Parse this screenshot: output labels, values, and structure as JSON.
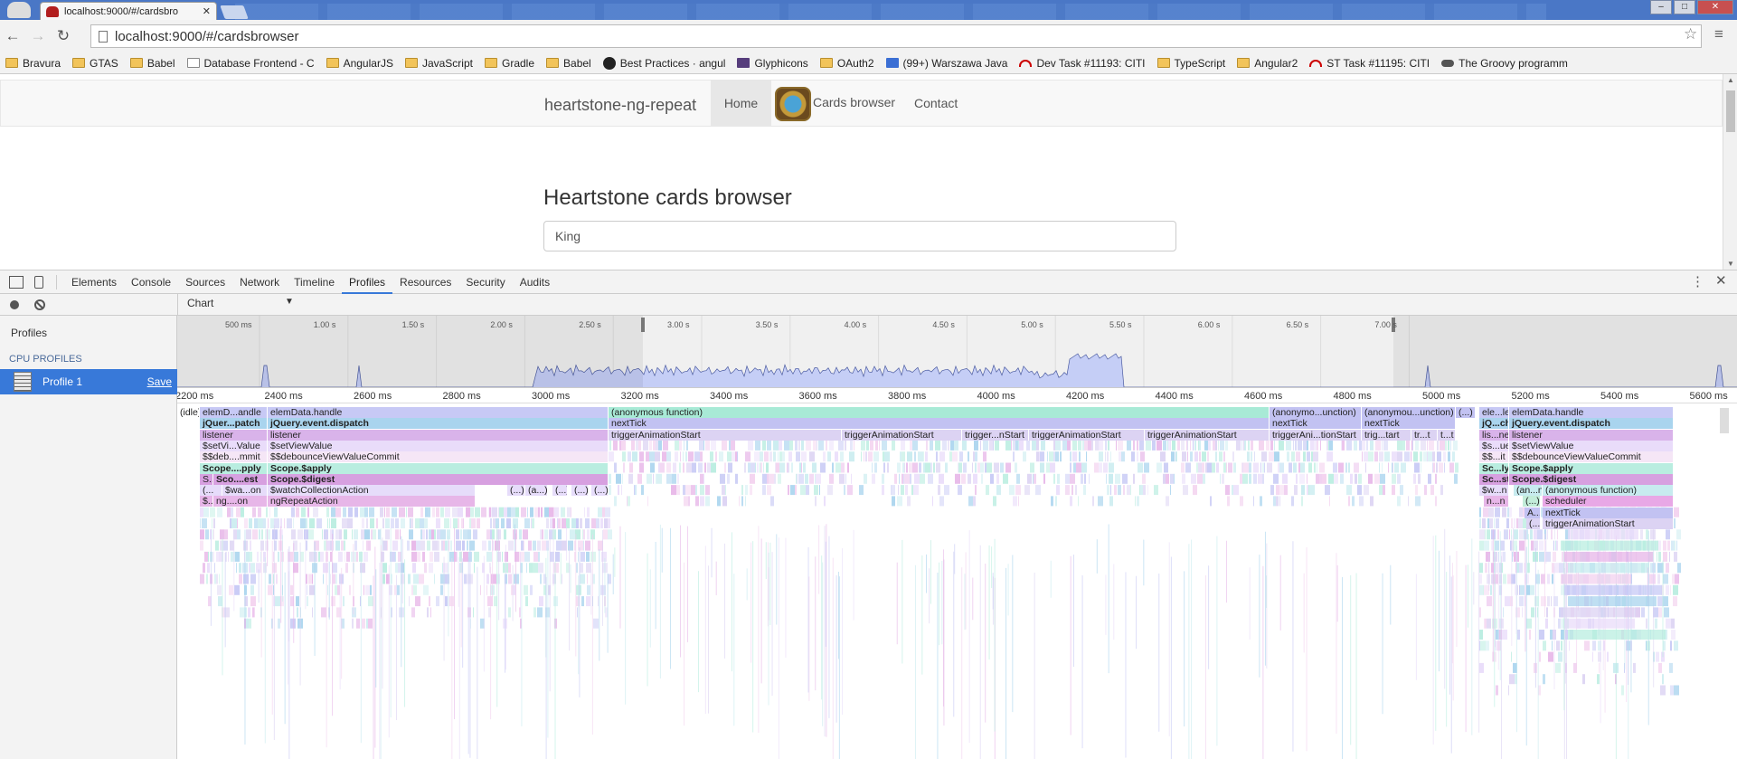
{
  "browser": {
    "tab_title": "localhost:9000/#/cardsbro",
    "url": "localhost:9000/#/cardsbrowser",
    "bookmarks": [
      {
        "label": "Bravura",
        "icon": "folder"
      },
      {
        "label": "GTAS",
        "icon": "folder"
      },
      {
        "label": "Babel",
        "icon": "folder"
      },
      {
        "label": "Database Frontend - C",
        "icon": "page"
      },
      {
        "label": "AngularJS",
        "icon": "folder"
      },
      {
        "label": "JavaScript",
        "icon": "folder"
      },
      {
        "label": "Gradle",
        "icon": "folder"
      },
      {
        "label": "Babel",
        "icon": "folder"
      },
      {
        "label": "Best Practices · angul",
        "icon": "gh"
      },
      {
        "label": "Glyphicons",
        "icon": "bs"
      },
      {
        "label": "OAuth2",
        "icon": "folder"
      },
      {
        "label": "(99+) Warszawa Java",
        "icon": "doc"
      },
      {
        "label": "Dev Task #11193: CITI",
        "icon": "jira"
      },
      {
        "label": "TypeScript",
        "icon": "folder"
      },
      {
        "label": "Angular2",
        "icon": "folder"
      },
      {
        "label": "ST Task #11195: CITI",
        "icon": "jira"
      },
      {
        "label": "The Groovy programm",
        "icon": "car"
      }
    ]
  },
  "page": {
    "brand": "heartstone-ng-repeat",
    "nav": {
      "home": "Home",
      "cards": "Cards browser",
      "contact": "Contact"
    },
    "heading": "Heartstone cards browser",
    "search_value": "King"
  },
  "devtools": {
    "tabs": [
      "Elements",
      "Console",
      "Sources",
      "Network",
      "Timeline",
      "Profiles",
      "Resources",
      "Security",
      "Audits"
    ],
    "active_tab": "Profiles",
    "view_select": "Chart",
    "sidebar": {
      "header": "Profiles",
      "section": "CPU PROFILES",
      "profile_name": "Profile 1",
      "save_label": "Save"
    },
    "overview_ticks": [
      "500 ms",
      "1.00 s",
      "1.50 s",
      "2.00 s",
      "2.50 s",
      "3.00 s",
      "3.50 s",
      "4.00 s",
      "4.50 s",
      "5.00 s",
      "5.50 s",
      "6.00 s",
      "6.50 s",
      "7.00 s"
    ],
    "ruler_ticks": [
      "2200 ms",
      "2400 ms",
      "2600 ms",
      "2800 ms",
      "3000 ms",
      "3200 ms",
      "3400 ms",
      "3600 ms",
      "3800 ms",
      "4000 ms",
      "4200 ms",
      "4400 ms",
      "4600 ms",
      "4800 ms",
      "5000 ms",
      "5200 ms",
      "5400 ms",
      "5600 ms"
    ],
    "flame_bars": [
      {
        "row": 0,
        "start": 0,
        "end": 25,
        "label": "(idle)",
        "color": "#ffffff"
      },
      {
        "row": 0,
        "start": 25,
        "end": 100,
        "label": "elemD...andle",
        "color": "#c7c9f5"
      },
      {
        "row": 0,
        "start": 100,
        "end": 477,
        "label": "elemData.handle",
        "color": "#c7c9f5"
      },
      {
        "row": 0,
        "start": 477,
        "end": 1208,
        "label": "(anonymous function)",
        "color": "#a8ead6"
      },
      {
        "row": 0,
        "start": 1208,
        "end": 1310,
        "label": "(anonymo...unction)",
        "color": "#c2c2f2"
      },
      {
        "row": 0,
        "start": 1310,
        "end": 1414,
        "label": "(anonymou...unction)",
        "color": "#c2c2f2"
      },
      {
        "row": 0,
        "start": 1414,
        "end": 1436,
        "label": "(...)",
        "color": "#c2c2f2"
      },
      {
        "row": 0,
        "start": 1440,
        "end": 1473,
        "label": "ele...le",
        "color": "#c7c9f5"
      },
      {
        "row": 0,
        "start": 1473,
        "end": 1655,
        "label": "elemData.handle",
        "color": "#c7c9f5"
      },
      {
        "row": 1,
        "start": 25,
        "end": 100,
        "label": "jQuer...patch",
        "color": "#a9d4ee",
        "bold": true
      },
      {
        "row": 1,
        "start": 100,
        "end": 477,
        "label": "jQuery.event.dispatch",
        "color": "#a9d4ee",
        "bold": true
      },
      {
        "row": 1,
        "start": 477,
        "end": 1208,
        "label": "nextTick",
        "color": "#c2c2f2"
      },
      {
        "row": 1,
        "start": 1208,
        "end": 1310,
        "label": "nextTick",
        "color": "#c2c2f2"
      },
      {
        "row": 1,
        "start": 1310,
        "end": 1414,
        "label": "nextTick",
        "color": "#c2c2f2"
      },
      {
        "row": 1,
        "start": 1440,
        "end": 1473,
        "label": "jQ...ch",
        "color": "#a9d4ee",
        "bold": true
      },
      {
        "row": 1,
        "start": 1473,
        "end": 1655,
        "label": "jQuery.event.dispatch",
        "color": "#a9d4ee",
        "bold": true
      },
      {
        "row": 2,
        "start": 25,
        "end": 100,
        "label": "listener",
        "color": "#d9b3ea"
      },
      {
        "row": 2,
        "start": 100,
        "end": 477,
        "label": "listener",
        "color": "#d9b3ea"
      },
      {
        "row": 2,
        "start": 477,
        "end": 735,
        "label": "triggerAnimationStart",
        "color": "#dcd3f3"
      },
      {
        "row": 2,
        "start": 735,
        "end": 868,
        "label": "triggerAnimationStart",
        "color": "#dcd3f3"
      },
      {
        "row": 2,
        "start": 868,
        "end": 942,
        "label": "trigger...nStart",
        "color": "#dcd3f3"
      },
      {
        "row": 2,
        "start": 942,
        "end": 1070,
        "label": "triggerAnimationStart",
        "color": "#dcd3f3"
      },
      {
        "row": 2,
        "start": 1070,
        "end": 1208,
        "label": "triggerAnimationStart",
        "color": "#dcd3f3"
      },
      {
        "row": 2,
        "start": 1208,
        "end": 1310,
        "label": "triggerAni...tionStart",
        "color": "#dcd3f3"
      },
      {
        "row": 2,
        "start": 1310,
        "end": 1365,
        "label": "trig...tart",
        "color": "#dcd3f3"
      },
      {
        "row": 2,
        "start": 1365,
        "end": 1394,
        "label": "tr...t",
        "color": "#dcd3f3"
      },
      {
        "row": 2,
        "start": 1394,
        "end": 1414,
        "label": "t...t",
        "color": "#dcd3f3"
      },
      {
        "row": 2,
        "start": 1440,
        "end": 1473,
        "label": "lis...ner",
        "color": "#d9b3ea"
      },
      {
        "row": 2,
        "start": 1473,
        "end": 1655,
        "label": "listener",
        "color": "#d9b3ea"
      },
      {
        "row": 3,
        "start": 25,
        "end": 100,
        "label": "$setVi...Value",
        "color": "#e9dcfa"
      },
      {
        "row": 3,
        "start": 100,
        "end": 477,
        "label": "$setViewValue",
        "color": "#e9dcfa"
      },
      {
        "row": 3,
        "start": 1440,
        "end": 1473,
        "label": "$s...ue",
        "color": "#e9dcfa"
      },
      {
        "row": 3,
        "start": 1473,
        "end": 1655,
        "label": "$setViewValue",
        "color": "#e9dcfa"
      },
      {
        "row": 4,
        "start": 25,
        "end": 100,
        "label": "$$deb....mmit",
        "color": "#f5e6f6"
      },
      {
        "row": 4,
        "start": 100,
        "end": 477,
        "label": "$$debounceViewValueCommit",
        "color": "#f5e6f6"
      },
      {
        "row": 4,
        "start": 1440,
        "end": 1473,
        "label": "$$...it",
        "color": "#f5e6f6"
      },
      {
        "row": 4,
        "start": 1473,
        "end": 1655,
        "label": "$$debounceViewValueCommit",
        "color": "#f5e6f6"
      },
      {
        "row": 5,
        "start": 25,
        "end": 100,
        "label": "Scope....pply",
        "color": "#b9ede0",
        "bold": true
      },
      {
        "row": 5,
        "start": 100,
        "end": 477,
        "label": "Scope.$apply",
        "color": "#b9ede0",
        "bold": true
      },
      {
        "row": 5,
        "start": 1440,
        "end": 1473,
        "label": "Sc...ly",
        "color": "#b9ede0",
        "bold": true
      },
      {
        "row": 5,
        "start": 1473,
        "end": 1655,
        "label": "Scope.$apply",
        "color": "#b9ede0",
        "bold": true
      },
      {
        "row": 6,
        "start": 25,
        "end": 40,
        "label": "S...",
        "color": "#d7a0e0"
      },
      {
        "row": 6,
        "start": 40,
        "end": 100,
        "label": "Sco....est",
        "color": "#d7a0e0",
        "bold": true
      },
      {
        "row": 6,
        "start": 100,
        "end": 477,
        "label": "Scope.$digest",
        "color": "#d7a0e0",
        "bold": true
      },
      {
        "row": 6,
        "start": 1440,
        "end": 1473,
        "label": "Sc...st",
        "color": "#d7a0e0",
        "bold": true
      },
      {
        "row": 6,
        "start": 1473,
        "end": 1655,
        "label": "Scope.$digest",
        "color": "#d7a0e0",
        "bold": true
      },
      {
        "row": 7,
        "start": 25,
        "end": 50,
        "label": "(...",
        "color": "#e6dcfa"
      },
      {
        "row": 7,
        "start": 50,
        "end": 100,
        "label": "$wa...on",
        "color": "#e6dcfa"
      },
      {
        "row": 7,
        "start": 100,
        "end": 330,
        "label": "$watchCollectionAction",
        "color": "#e6dcfa"
      },
      {
        "row": 7,
        "start": 365,
        "end": 385,
        "label": "(...)",
        "color": "#e6dcfa"
      },
      {
        "row": 7,
        "start": 385,
        "end": 410,
        "label": "(a...)",
        "color": "#e6dcfa"
      },
      {
        "row": 7,
        "start": 415,
        "end": 432,
        "label": "(...)",
        "color": "#e6dcfa"
      },
      {
        "row": 7,
        "start": 436,
        "end": 455,
        "label": "(...)",
        "color": "#e6dcfa"
      },
      {
        "row": 7,
        "start": 458,
        "end": 477,
        "label": "(...)",
        "color": "#e6dcfa"
      },
      {
        "row": 7,
        "start": 1440,
        "end": 1473,
        "label": "$w...n",
        "color": "#e6dcfa"
      },
      {
        "row": 7,
        "start": 1478,
        "end": 1510,
        "label": "(an...n)",
        "color": "#c7ebef"
      },
      {
        "row": 7,
        "start": 1510,
        "end": 1655,
        "label": "(anonymous function)",
        "color": "#c7ebef"
      },
      {
        "row": 8,
        "start": 25,
        "end": 40,
        "label": "$...",
        "color": "#e7b6e8"
      },
      {
        "row": 8,
        "start": 40,
        "end": 100,
        "label": "ng....on",
        "color": "#e7b6e8"
      },
      {
        "row": 8,
        "start": 100,
        "end": 330,
        "label": "ngRepeatAction",
        "color": "#e7b6e8"
      },
      {
        "row": 8,
        "start": 1445,
        "end": 1473,
        "label": "n...n",
        "color": "#e7b6e8"
      },
      {
        "row": 8,
        "start": 1488,
        "end": 1508,
        "label": "(...)",
        "color": "#c2ecd9"
      },
      {
        "row": 8,
        "start": 1510,
        "end": 1655,
        "label": "scheduler",
        "color": "#e8a8e6"
      },
      {
        "row": 9,
        "start": 1490,
        "end": 1508,
        "label": "A...",
        "color": "#c2c2f2"
      },
      {
        "row": 9,
        "start": 1510,
        "end": 1655,
        "label": "nextTick",
        "color": "#c2c2f2"
      },
      {
        "row": 10,
        "start": 1492,
        "end": 1508,
        "label": "(...",
        "color": "#dcd3f3"
      },
      {
        "row": 10,
        "start": 1510,
        "end": 1655,
        "label": "triggerAnimationStart",
        "color": "#dcd3f3"
      }
    ],
    "colors": {
      "active_blue": "#3879d9",
      "overview_fill": "#c5cef6"
    }
  }
}
